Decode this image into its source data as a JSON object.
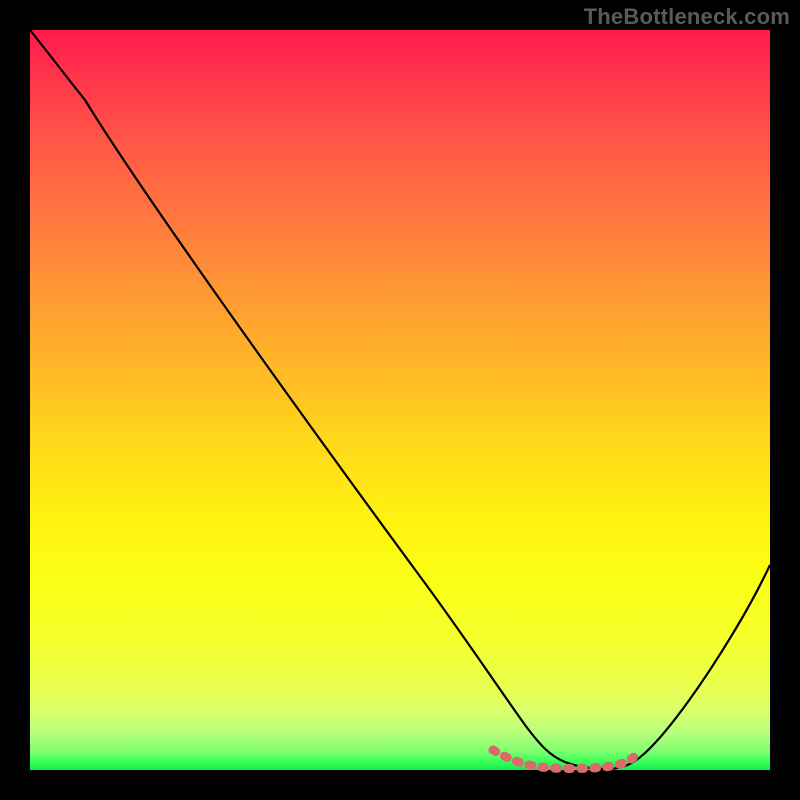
{
  "watermark": "TheBottleneck.com",
  "colors": {
    "background": "#000000",
    "watermark": "#5a5a5a",
    "curve": "#000000",
    "marker": "#d96b6b",
    "gradient_top": "#ff1a4d",
    "gradient_bottom": "#16e84e"
  },
  "chart_data": {
    "type": "line",
    "title": "",
    "xlabel": "",
    "ylabel": "",
    "xlim": [
      0,
      100
    ],
    "ylim": [
      0,
      100
    ],
    "grid": false,
    "legend": false,
    "series": [
      {
        "name": "bottleneck-curve",
        "x": [
          0,
          4,
          10,
          20,
          30,
          40,
          50,
          58,
          62,
          66,
          68,
          70,
          72,
          74,
          76,
          78,
          80,
          82,
          86,
          90,
          95,
          100
        ],
        "y": [
          100,
          96,
          90,
          77,
          63,
          50,
          36,
          25,
          18,
          10,
          6,
          3,
          1,
          0,
          0,
          0,
          0,
          1,
          5,
          12,
          24,
          40
        ]
      },
      {
        "name": "optimal-range-marker",
        "x": [
          62,
          66,
          68,
          70,
          72,
          74,
          76,
          78,
          80,
          81
        ],
        "y": [
          2.2,
          1.2,
          0.9,
          0.8,
          0.8,
          0.8,
          0.8,
          0.9,
          1.0,
          1.5
        ]
      }
    ],
    "annotations": []
  }
}
